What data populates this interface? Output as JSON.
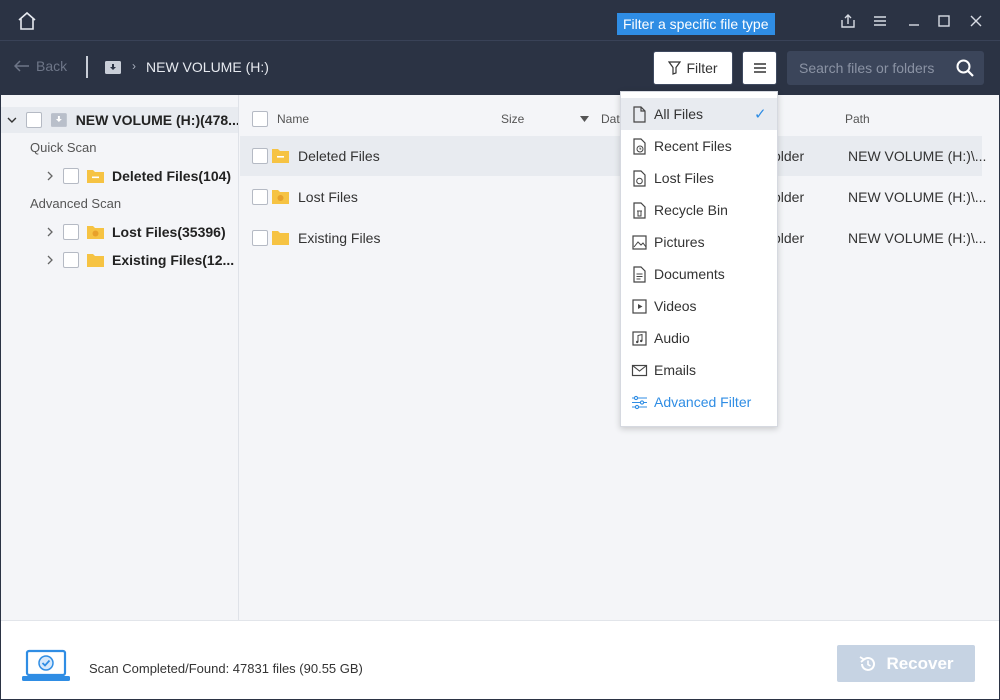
{
  "titlebar": {
    "tooltip": "Filter a specific file type"
  },
  "toolbar": {
    "back_label": "Back",
    "breadcrumb": "NEW VOLUME (H:)",
    "filter_label": "Filter",
    "search_placeholder": "Search files or folders"
  },
  "sidebar": {
    "root_label": "NEW VOLUME (H:)(478...",
    "quick_scan_label": "Quick Scan",
    "advanced_scan_label": "Advanced Scan",
    "items": [
      {
        "label": "Deleted Files(104)"
      },
      {
        "label": "Lost Files(35396)"
      },
      {
        "label": "Existing Files(12..."
      }
    ]
  },
  "table": {
    "columns": {
      "name": "Name",
      "size": "Size",
      "date": "Dat",
      "path": "Path"
    },
    "rows": [
      {
        "name": "Deleted Files",
        "type": "older",
        "path": "NEW VOLUME (H:)\\..."
      },
      {
        "name": "Lost Files",
        "type": "older",
        "path": "NEW VOLUME (H:)\\..."
      },
      {
        "name": "Existing Files",
        "type": "older",
        "path": "NEW VOLUME (H:)\\..."
      }
    ]
  },
  "filter_menu": {
    "items": [
      {
        "label": "All Files",
        "icon": "file-icon",
        "selected": true
      },
      {
        "label": "Recent Files",
        "icon": "recent-file-icon"
      },
      {
        "label": "Lost Files",
        "icon": "lost-file-icon"
      },
      {
        "label": "Recycle Bin",
        "icon": "recycle-bin-icon"
      },
      {
        "label": "Pictures",
        "icon": "picture-icon"
      },
      {
        "label": "Documents",
        "icon": "document-icon"
      },
      {
        "label": "Videos",
        "icon": "video-icon"
      },
      {
        "label": "Audio",
        "icon": "audio-icon"
      },
      {
        "label": "Emails",
        "icon": "email-icon"
      },
      {
        "label": "Advanced Filter",
        "icon": "sliders-icon"
      }
    ],
    "check_mark": "✓"
  },
  "footer": {
    "status": "Scan Completed/Found: 47831 files (90.55 GB)",
    "recover_label": "Recover"
  },
  "colors": {
    "titlebar_bg": "#2b3344",
    "accent": "#2f8de4",
    "folder": "#f6c343"
  }
}
